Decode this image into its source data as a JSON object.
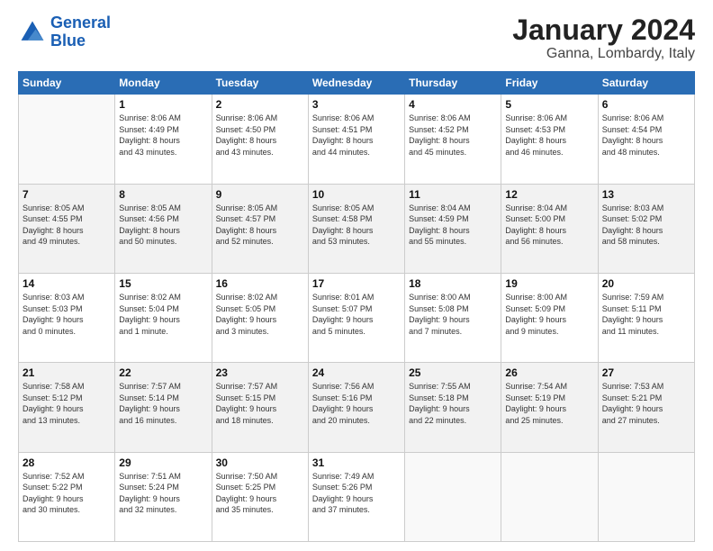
{
  "header": {
    "logo_general": "General",
    "logo_blue": "Blue",
    "month": "January 2024",
    "location": "Ganna, Lombardy, Italy"
  },
  "days_of_week": [
    "Sunday",
    "Monday",
    "Tuesday",
    "Wednesday",
    "Thursday",
    "Friday",
    "Saturday"
  ],
  "weeks": [
    [
      {
        "day": "",
        "info": ""
      },
      {
        "day": "1",
        "info": "Sunrise: 8:06 AM\nSunset: 4:49 PM\nDaylight: 8 hours\nand 43 minutes."
      },
      {
        "day": "2",
        "info": "Sunrise: 8:06 AM\nSunset: 4:50 PM\nDaylight: 8 hours\nand 43 minutes."
      },
      {
        "day": "3",
        "info": "Sunrise: 8:06 AM\nSunset: 4:51 PM\nDaylight: 8 hours\nand 44 minutes."
      },
      {
        "day": "4",
        "info": "Sunrise: 8:06 AM\nSunset: 4:52 PM\nDaylight: 8 hours\nand 45 minutes."
      },
      {
        "day": "5",
        "info": "Sunrise: 8:06 AM\nSunset: 4:53 PM\nDaylight: 8 hours\nand 46 minutes."
      },
      {
        "day": "6",
        "info": "Sunrise: 8:06 AM\nSunset: 4:54 PM\nDaylight: 8 hours\nand 48 minutes."
      }
    ],
    [
      {
        "day": "7",
        "info": "Sunrise: 8:05 AM\nSunset: 4:55 PM\nDaylight: 8 hours\nand 49 minutes."
      },
      {
        "day": "8",
        "info": "Sunrise: 8:05 AM\nSunset: 4:56 PM\nDaylight: 8 hours\nand 50 minutes."
      },
      {
        "day": "9",
        "info": "Sunrise: 8:05 AM\nSunset: 4:57 PM\nDaylight: 8 hours\nand 52 minutes."
      },
      {
        "day": "10",
        "info": "Sunrise: 8:05 AM\nSunset: 4:58 PM\nDaylight: 8 hours\nand 53 minutes."
      },
      {
        "day": "11",
        "info": "Sunrise: 8:04 AM\nSunset: 4:59 PM\nDaylight: 8 hours\nand 55 minutes."
      },
      {
        "day": "12",
        "info": "Sunrise: 8:04 AM\nSunset: 5:00 PM\nDaylight: 8 hours\nand 56 minutes."
      },
      {
        "day": "13",
        "info": "Sunrise: 8:03 AM\nSunset: 5:02 PM\nDaylight: 8 hours\nand 58 minutes."
      }
    ],
    [
      {
        "day": "14",
        "info": "Sunrise: 8:03 AM\nSunset: 5:03 PM\nDaylight: 9 hours\nand 0 minutes."
      },
      {
        "day": "15",
        "info": "Sunrise: 8:02 AM\nSunset: 5:04 PM\nDaylight: 9 hours\nand 1 minute."
      },
      {
        "day": "16",
        "info": "Sunrise: 8:02 AM\nSunset: 5:05 PM\nDaylight: 9 hours\nand 3 minutes."
      },
      {
        "day": "17",
        "info": "Sunrise: 8:01 AM\nSunset: 5:07 PM\nDaylight: 9 hours\nand 5 minutes."
      },
      {
        "day": "18",
        "info": "Sunrise: 8:00 AM\nSunset: 5:08 PM\nDaylight: 9 hours\nand 7 minutes."
      },
      {
        "day": "19",
        "info": "Sunrise: 8:00 AM\nSunset: 5:09 PM\nDaylight: 9 hours\nand 9 minutes."
      },
      {
        "day": "20",
        "info": "Sunrise: 7:59 AM\nSunset: 5:11 PM\nDaylight: 9 hours\nand 11 minutes."
      }
    ],
    [
      {
        "day": "21",
        "info": "Sunrise: 7:58 AM\nSunset: 5:12 PM\nDaylight: 9 hours\nand 13 minutes."
      },
      {
        "day": "22",
        "info": "Sunrise: 7:57 AM\nSunset: 5:14 PM\nDaylight: 9 hours\nand 16 minutes."
      },
      {
        "day": "23",
        "info": "Sunrise: 7:57 AM\nSunset: 5:15 PM\nDaylight: 9 hours\nand 18 minutes."
      },
      {
        "day": "24",
        "info": "Sunrise: 7:56 AM\nSunset: 5:16 PM\nDaylight: 9 hours\nand 20 minutes."
      },
      {
        "day": "25",
        "info": "Sunrise: 7:55 AM\nSunset: 5:18 PM\nDaylight: 9 hours\nand 22 minutes."
      },
      {
        "day": "26",
        "info": "Sunrise: 7:54 AM\nSunset: 5:19 PM\nDaylight: 9 hours\nand 25 minutes."
      },
      {
        "day": "27",
        "info": "Sunrise: 7:53 AM\nSunset: 5:21 PM\nDaylight: 9 hours\nand 27 minutes."
      }
    ],
    [
      {
        "day": "28",
        "info": "Sunrise: 7:52 AM\nSunset: 5:22 PM\nDaylight: 9 hours\nand 30 minutes."
      },
      {
        "day": "29",
        "info": "Sunrise: 7:51 AM\nSunset: 5:24 PM\nDaylight: 9 hours\nand 32 minutes."
      },
      {
        "day": "30",
        "info": "Sunrise: 7:50 AM\nSunset: 5:25 PM\nDaylight: 9 hours\nand 35 minutes."
      },
      {
        "day": "31",
        "info": "Sunrise: 7:49 AM\nSunset: 5:26 PM\nDaylight: 9 hours\nand 37 minutes."
      },
      {
        "day": "",
        "info": ""
      },
      {
        "day": "",
        "info": ""
      },
      {
        "day": "",
        "info": ""
      }
    ]
  ]
}
